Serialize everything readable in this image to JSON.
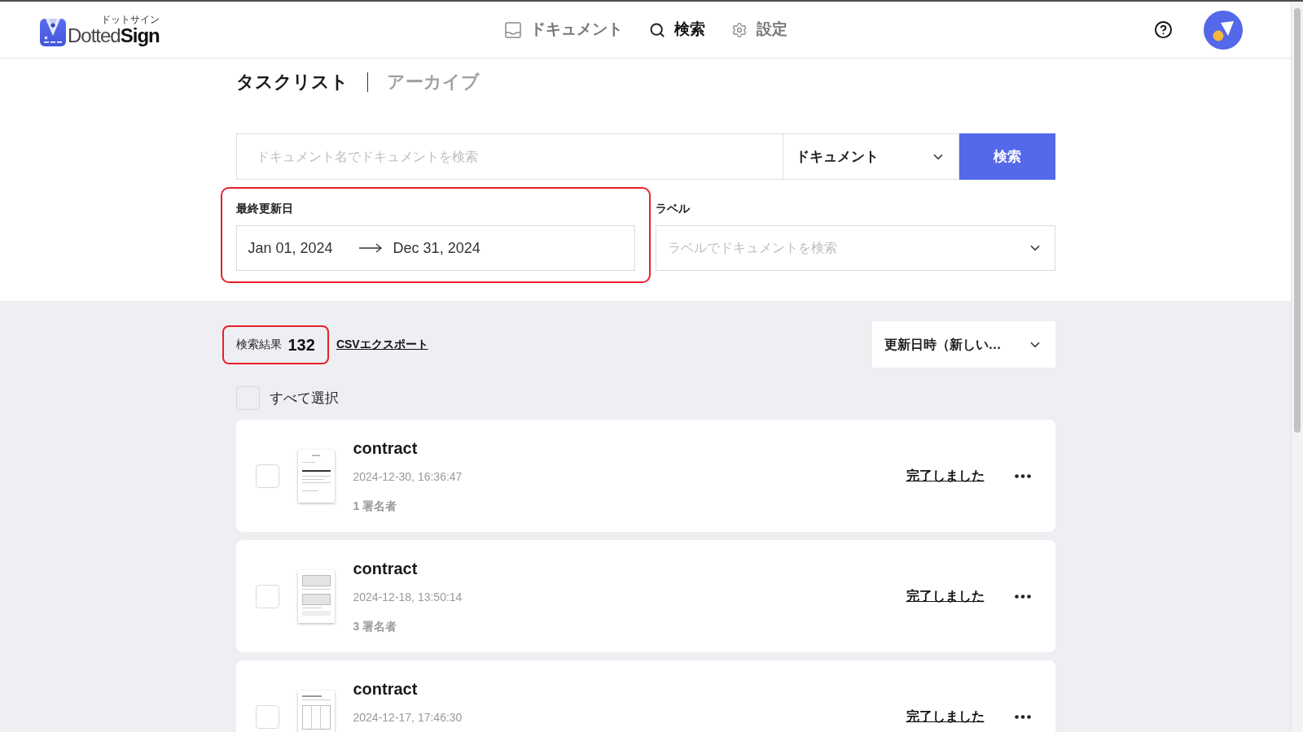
{
  "header": {
    "logo": {
      "subtitle": "ドットサイン",
      "wordmark": "Dotted**Sign**"
    },
    "nav": [
      {
        "label": "ドキュメント",
        "selected": false
      },
      {
        "label": "検索",
        "selected": true
      },
      {
        "label": "設定",
        "selected": false
      }
    ]
  },
  "tabs": [
    {
      "label": "タスクリスト",
      "selected": true
    },
    {
      "label": "アーカイブ",
      "selected": false
    }
  ],
  "search": {
    "placeholder": "ドキュメント名でドキュメントを検索",
    "scope": "ドキュメント",
    "button": "検索"
  },
  "filters": [
    {
      "kind": "date_range",
      "label": "最終更新日",
      "from": "Jan 01, 2024",
      "to": "Dec 31, 2024",
      "highlighted": true
    },
    {
      "kind": "select",
      "label": "ラベル",
      "placeholder": "ラベルでドキュメントを検索",
      "highlighted": false
    }
  ],
  "results": {
    "label": "検索結果",
    "count": "132",
    "highlighted": true,
    "export_link": "CSVエクスポート",
    "sort": "更新日時（新しい…"
  },
  "select_all": {
    "label": "すべて選択",
    "checked": false
  },
  "documents": [
    {
      "title": "contract",
      "updated": "2024-12-30, 16:36:47",
      "signers": "1 署名者",
      "status": "完了しました",
      "checked": false
    },
    {
      "title": "contract",
      "updated": "2024-12-18, 13:50:14",
      "signers": "3 署名者",
      "status": "完了しました",
      "checked": false
    },
    {
      "title": "contract",
      "updated": "2024-12-17, 17:46:30",
      "status": "完了しました",
      "checked": false
    }
  ]
}
